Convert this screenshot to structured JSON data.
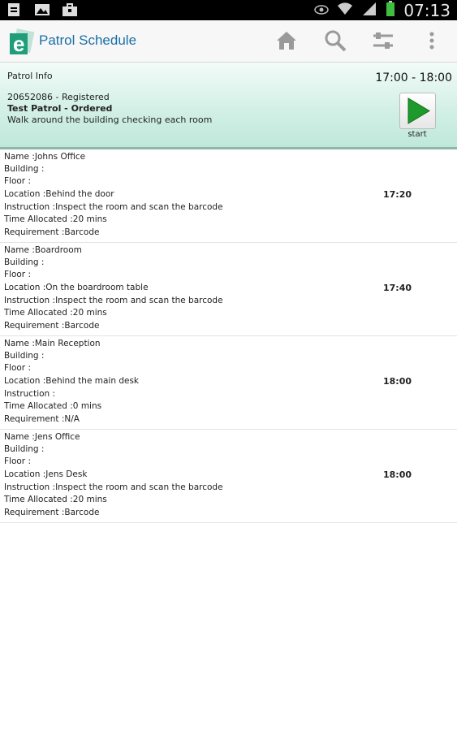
{
  "status_bar": {
    "time": "07:13",
    "icons": [
      "document-icon",
      "image-icon",
      "briefcase-icon",
      "eye-icon",
      "wifi-icon",
      "signal-icon",
      "battery-icon"
    ]
  },
  "action_bar": {
    "title": "Patrol Schedule",
    "actions": [
      "home-icon",
      "search-icon",
      "settings-sliders-icon",
      "overflow-menu-icon"
    ]
  },
  "patrol": {
    "header": "Patrol Info",
    "time_range": "17:00 - 18:00",
    "line1": "20652086 - Registered",
    "line2": "Test Patrol - Ordered",
    "line3": "Walk around the building checking each room",
    "start_label": "start"
  },
  "items": [
    {
      "name": "Name :Johns Office",
      "building": "Building :",
      "floor": "Floor :",
      "location": "Location :Behind the door",
      "instruction": "Instruction :Inspect the room and scan the barcode",
      "time_allocated": "Time Allocated :20 mins",
      "requirement": "Requirement :Barcode",
      "time": "17:20"
    },
    {
      "name": "Name :Boardroom",
      "building": "Building :",
      "floor": "Floor :",
      "location": "Location :On the boardroom table",
      "instruction": "Instruction :Inspect the room and scan the barcode",
      "time_allocated": "Time Allocated :20 mins",
      "requirement": "Requirement :Barcode",
      "time": "17:40"
    },
    {
      "name": "Name :Main Reception",
      "building": "Building :",
      "floor": "Floor :",
      "location": "Location :Behind the main desk",
      "instruction": "Instruction :",
      "time_allocated": "Time Allocated :0 mins",
      "requirement": "Requirement :N/A",
      "time": "18:00"
    },
    {
      "name": "Name :Jens Office",
      "building": "Building :",
      "floor": "Floor :",
      "location": "Location :Jens Desk",
      "instruction": "Instruction :Inspect the room and scan the barcode",
      "time_allocated": "Time Allocated :20 mins",
      "requirement": "Requirement :Barcode",
      "time": "18:00"
    }
  ],
  "colors": {
    "title_blue": "#1a6fa8",
    "info_green": "#cdeee2",
    "play_green": "#1e9a2c"
  }
}
